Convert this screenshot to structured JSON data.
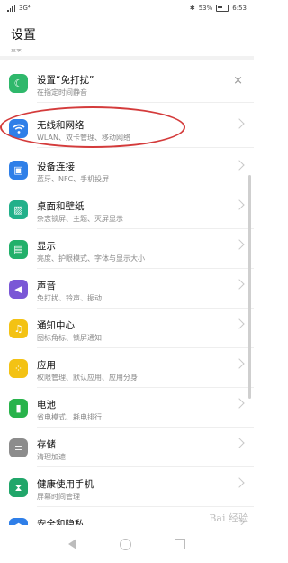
{
  "status": {
    "left": "3G⁴",
    "battery_pct": "53%",
    "time": "6:53"
  },
  "header": {
    "title": "设置"
  },
  "clipped_text": "登录",
  "items": [
    {
      "title": "设置“免打扰”",
      "sub": "在指定时间静音",
      "icon": "moon-icon",
      "color": "#2fb86b",
      "action": "×"
    },
    {
      "title": "无线和网络",
      "sub": "WLAN、双卡管理、移动网络",
      "icon": "wifi-icon",
      "color": "#2f7fe8"
    },
    {
      "title": "设备连接",
      "sub": "蓝牙、NFC、手机投屏",
      "icon": "device-link-icon",
      "color": "#2f7fe8"
    },
    {
      "title": "桌面和壁纸",
      "sub": "杂志锁屏、主题、灭屏显示",
      "icon": "wallpaper-icon",
      "color": "#22b08a"
    },
    {
      "title": "显示",
      "sub": "亮度、护眼模式、字体与显示大小",
      "icon": "display-icon",
      "color": "#22b06a"
    },
    {
      "title": "声音",
      "sub": "免打扰、铃声、振动",
      "icon": "sound-icon",
      "color": "#7a57d6"
    },
    {
      "title": "通知中心",
      "sub": "图标角标、锁屏通知",
      "icon": "bell-icon",
      "color": "#f3c214"
    },
    {
      "title": "应用",
      "sub": "权限管理、默认应用、应用分身",
      "icon": "apps-icon",
      "color": "#f3c214"
    },
    {
      "title": "电池",
      "sub": "省电模式、耗电排行",
      "icon": "battery-icon",
      "color": "#28b34b"
    },
    {
      "title": "存储",
      "sub": "清理加速",
      "icon": "storage-icon",
      "color": "#8c8c8c"
    },
    {
      "title": "健康使用手机",
      "sub": "屏幕时间管理",
      "icon": "hourglass-icon",
      "color": "#21a66a"
    },
    {
      "title": "安全和隐私",
      "sub": "",
      "icon": "lock-icon",
      "color": "#2f7fe8"
    }
  ],
  "watermark": "Bai 经验"
}
